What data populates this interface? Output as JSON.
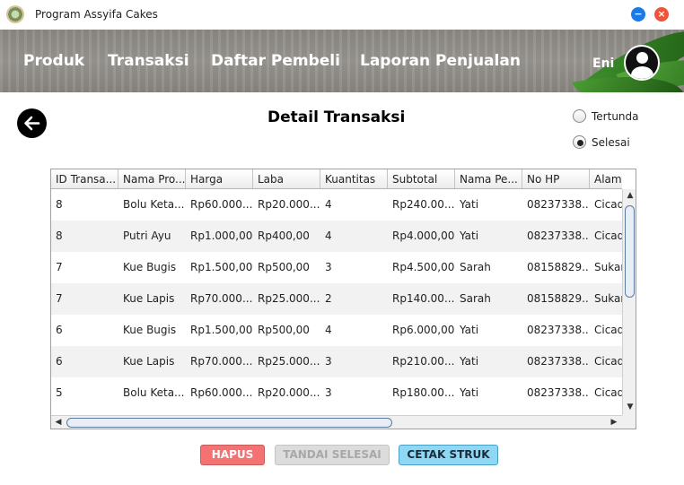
{
  "window": {
    "title": "Program Assyifa Cakes",
    "minimize_symbol": "−",
    "close_symbol": "×"
  },
  "nav": {
    "items": [
      "Produk",
      "Transaksi",
      "Daftar Pembeli",
      "Laporan Penjualan"
    ],
    "user_name": "Eni"
  },
  "page": {
    "title": "Detail Transaksi"
  },
  "filter": {
    "options": [
      "Tertunda",
      "Selesai"
    ],
    "selected": "Selesai"
  },
  "table": {
    "columns": [
      "ID Transa...",
      "Nama Pro...",
      "Harga",
      "Laba",
      "Kuantitas",
      "Subtotal",
      "Nama Pe...",
      "No HP",
      "Alama"
    ],
    "rows": [
      [
        "8",
        "Bolu Keta...",
        "Rp60.000...",
        "Rp20.000...",
        "4",
        "Rp240.00...",
        "Yati",
        "08237338...",
        "Cicad"
      ],
      [
        "8",
        "Putri Ayu",
        "Rp1.000,00",
        "Rp400,00",
        "4",
        "Rp4.000,00",
        "Yati",
        "08237338...",
        "Cicad"
      ],
      [
        "7",
        "Kue Bugis",
        "Rp1.500,00",
        "Rp500,00",
        "3",
        "Rp4.500,00",
        "Sarah",
        "08158829...",
        "Sukar"
      ],
      [
        "7",
        "Kue Lapis",
        "Rp70.000...",
        "Rp25.000...",
        "2",
        "Rp140.00...",
        "Sarah",
        "08158829...",
        "Sukar"
      ],
      [
        "6",
        "Kue Bugis",
        "Rp1.500,00",
        "Rp500,00",
        "4",
        "Rp6.000,00",
        "Yati",
        "08237338...",
        "Cicad"
      ],
      [
        "6",
        "Kue Lapis",
        "Rp70.000...",
        "Rp25.000...",
        "3",
        "Rp210.00...",
        "Yati",
        "08237338...",
        "Cicad"
      ],
      [
        "5",
        "Bolu Keta...",
        "Rp60.000...",
        "Rp20.000...",
        "3",
        "Rp180.00...",
        "Yati",
        "08237338...",
        "Cicad"
      ]
    ]
  },
  "buttons": {
    "hapus": "HAPUS",
    "tandai_selesai": "TANDAI SELESAI",
    "cetak_struk": "CETAK STRUK"
  },
  "colors": {
    "hapus_bg": "#f47272",
    "tandai_bg": "#dcdcdc",
    "cetak_bg": "#8fd8f4",
    "minimize": "#1a7ae8",
    "close": "#f0533a"
  },
  "icons": {
    "back": "arrow-left-icon",
    "user": "user-avatar-icon",
    "app": "app-logo-icon"
  }
}
